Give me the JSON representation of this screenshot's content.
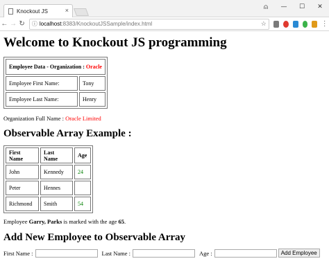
{
  "browser": {
    "tab_title": "Knockout JS",
    "tab_close": "×",
    "address_host": "localhost",
    "address_path": ":8383/KnockoutJSSample/index.html",
    "controls": {
      "account": "⍝",
      "minimize": "—",
      "maximize": "☐",
      "close": "✕"
    }
  },
  "page": {
    "heading": "Welcome to Knockout JS programming",
    "employee_table": {
      "header_label": "Employee Data - Organization : ",
      "header_org": "Oracle",
      "rows": [
        {
          "label": "Employee First Name:",
          "value": "Tony"
        },
        {
          "label": "Employee Last Name:",
          "value": "Henry"
        }
      ]
    },
    "org_full_name_label": "Organization Full Name : ",
    "org_full_name_value": "Oracle Limited",
    "observable_heading": "Observable Array Example :",
    "array_table": {
      "headers": [
        "First Name",
        "Last Name",
        "Age"
      ],
      "rows": [
        {
          "first": "John",
          "last": "Kennedy",
          "age": "24"
        },
        {
          "first": "Peter",
          "last": "Hennes",
          "age": ""
        },
        {
          "first": "Richmond",
          "last": "Smith",
          "age": "54"
        }
      ]
    },
    "marked_text": {
      "prefix": "Employee ",
      "name": "Garry, Parks",
      "middle": " is marked with the age ",
      "age": "65",
      "suffix": "."
    },
    "add_heading": "Add New Employee to Observable Array",
    "form": {
      "first_label": "First Name :",
      "first_value": "",
      "last_label": "Last Name :",
      "last_value": "",
      "age_label": "Age :",
      "age_value": "",
      "button_label": "Add Employee"
    }
  },
  "colors": {
    "highlight_red": "#ff0000",
    "age_green": "#008000"
  }
}
